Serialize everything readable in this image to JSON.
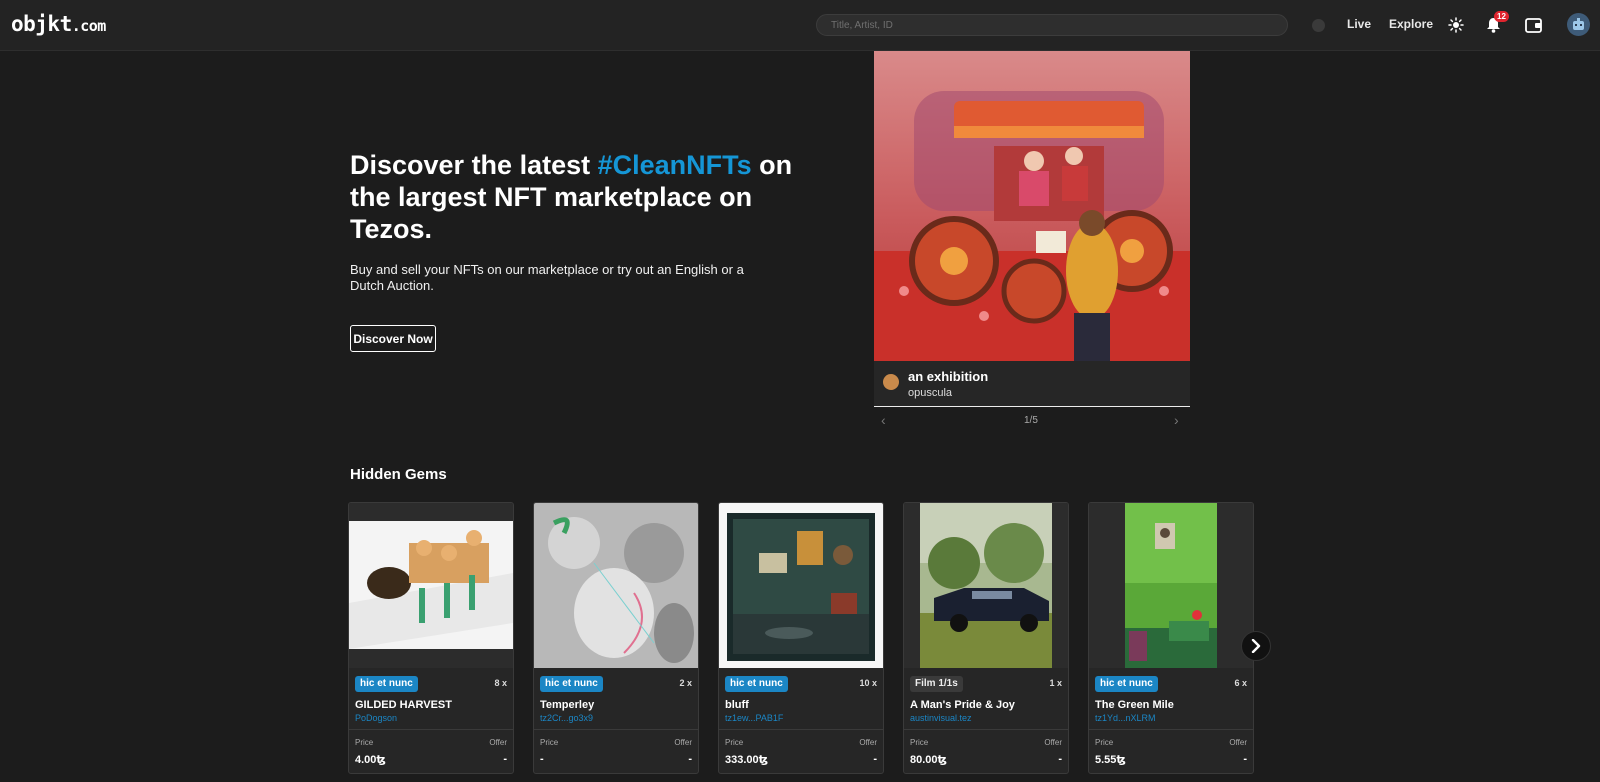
{
  "header": {
    "logo_main": "objkt",
    "logo_suffix": ".com",
    "search_placeholder": "Title, Artist, ID",
    "nav": [
      "Live",
      "Explore"
    ],
    "notification_count": "12"
  },
  "hero": {
    "title_before": "Discover the latest ",
    "title_highlight": "#CleanNFTs",
    "title_after": " on the largest NFT marketplace on Tezos.",
    "subtitle": "Buy and sell your NFTs on our marketplace or try out an English or a Dutch Auction.",
    "cta_label": "Discover Now",
    "highlight_color": "#1596d6"
  },
  "featured": {
    "title": "an exhibition",
    "artist": "opuscula",
    "pager": "1/5"
  },
  "hidden_gems": {
    "title": "Hidden Gems",
    "price_label": "Price",
    "offer_label": "Offer",
    "cards": [
      {
        "tag": "hic et nunc",
        "tag_type": "hen",
        "editions": "8 x",
        "title": "GILDED HARVEST",
        "artist": "PoDogson",
        "price": "4.00ꜩ",
        "offer": "-"
      },
      {
        "tag": "hic et nunc",
        "tag_type": "hen",
        "editions": "2 x",
        "title": "Temperley",
        "artist": "tz2Cr...go3x9",
        "price": "-",
        "offer": "-"
      },
      {
        "tag": "hic et nunc",
        "tag_type": "hen",
        "editions": "10 x",
        "title": "bluff",
        "artist": "tz1ew...PAB1F",
        "price": "333.00ꜩ",
        "offer": "-"
      },
      {
        "tag": "Film 1/1s",
        "tag_type": "film",
        "editions": "1 x",
        "title": "A Man's Pride & Joy",
        "artist": "austinvisual.tez",
        "price": "80.00ꜩ",
        "offer": "-"
      },
      {
        "tag": "hic et nunc",
        "tag_type": "hen",
        "editions": "6 x",
        "title": "The Green Mile",
        "artist": "tz1Yd...nXLRM",
        "price": "5.55ꜩ",
        "offer": "-"
      }
    ]
  }
}
